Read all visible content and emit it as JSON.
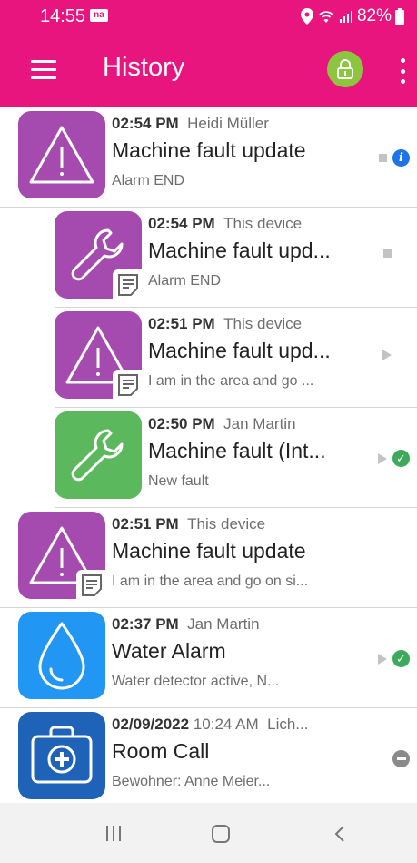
{
  "status_bar": {
    "time": "14:55",
    "notification_badge": "na",
    "battery": "82%",
    "icons": [
      "location-icon",
      "wifi-icon",
      "signal-icon",
      "battery-icon"
    ]
  },
  "app_bar": {
    "title": "History",
    "lock_color": "#8cc63f",
    "background_color": "#e8157e"
  },
  "items": [
    {
      "time": "02:54 PM",
      "source": "Heidi Müller",
      "title": "Machine fault update",
      "subtitle": "Alarm END",
      "icon": "alarm-triangle-icon",
      "icon_color": "#a54bb0",
      "document_badge": false,
      "indented": false,
      "status": [
        "stopped-square",
        "info-icon"
      ]
    },
    {
      "time": "02:54 PM",
      "source": "This device",
      "title": "Machine fault upd...",
      "subtitle": "Alarm END",
      "icon": "wrench-icon",
      "icon_color": "#a54bb0",
      "document_badge": true,
      "indented": true,
      "status": [
        "stopped-square"
      ]
    },
    {
      "time": "02:51 PM",
      "source": "This device",
      "title": "Machine fault upd...",
      "subtitle": "I am in the area and go ...",
      "icon": "alarm-triangle-icon",
      "icon_color": "#a54bb0",
      "document_badge": true,
      "indented": true,
      "status": [
        "play-triangle"
      ]
    },
    {
      "time": "02:50 PM",
      "source": "Jan Martin",
      "title": "Machine fault (Int...",
      "subtitle": "New fault",
      "icon": "wrench-icon",
      "icon_color": "#5cb85c",
      "document_badge": false,
      "indented": true,
      "status": [
        "play-triangle",
        "check-icon"
      ]
    },
    {
      "time": "02:51 PM",
      "source": "This device",
      "title": "Machine fault update",
      "subtitle": "I am in the area and go on si...",
      "icon": "alarm-triangle-icon",
      "icon_color": "#a54bb0",
      "document_badge": true,
      "indented": false,
      "status": []
    },
    {
      "time": "02:37 PM",
      "source": "Jan Martin",
      "title": "Water Alarm",
      "subtitle": "Water detector active, N...",
      "icon": "water-drop-icon",
      "icon_color": "#2196f3",
      "document_badge": false,
      "indented": false,
      "status": [
        "play-triangle",
        "check-icon"
      ]
    },
    {
      "time": "02/09/2022",
      "time_rest": "10:24 AM",
      "source": "Lich...",
      "title": "Room Call",
      "subtitle": "Bewohner: Anne Meier...",
      "icon": "medical-kit-icon",
      "icon_color": "#1e63b8",
      "document_badge": false,
      "indented": false,
      "status": [
        "minus-icon"
      ]
    }
  ],
  "nav_bar": {
    "buttons": [
      "recent-apps-icon",
      "home-icon",
      "back-icon"
    ]
  }
}
